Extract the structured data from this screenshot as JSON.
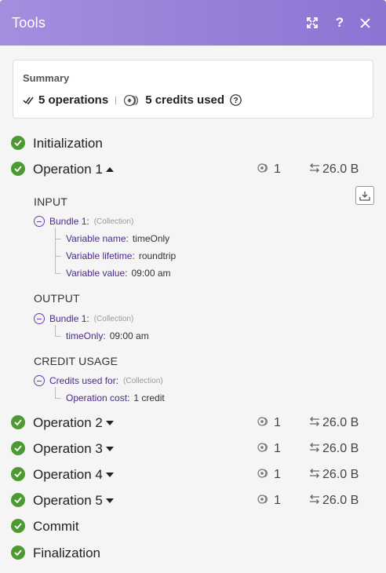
{
  "header": {
    "title": "Tools"
  },
  "summary": {
    "title": "Summary",
    "operations": "5 operations",
    "credits": "5 credits used"
  },
  "rows": {
    "initialization": "Initialization",
    "op1": {
      "label": "Operation 1",
      "count": "1",
      "size": "26.0 B"
    },
    "op2": {
      "label": "Operation 2",
      "count": "1",
      "size": "26.0 B"
    },
    "op3": {
      "label": "Operation 3",
      "count": "1",
      "size": "26.0 B"
    },
    "op4": {
      "label": "Operation 4",
      "count": "1",
      "size": "26.0 B"
    },
    "op5": {
      "label": "Operation 5",
      "count": "1",
      "size": "26.0 B"
    },
    "commit": "Commit",
    "finalization": "Finalization"
  },
  "details": {
    "input": {
      "heading": "INPUT",
      "bundle": "Bundle 1:",
      "type": "(Collection)",
      "items": [
        {
          "key": "Variable name:",
          "value": "timeOnly"
        },
        {
          "key": "Variable lifetime:",
          "value": "roundtrip"
        },
        {
          "key": "Variable value:",
          "value": "09:00 am"
        }
      ]
    },
    "output": {
      "heading": "OUTPUT",
      "bundle": "Bundle 1:",
      "type": "(Collection)",
      "items": [
        {
          "key": "timeOnly:",
          "value": "09:00 am"
        }
      ]
    },
    "credit_usage": {
      "heading": "CREDIT USAGE",
      "bundle": "Credits used for:",
      "type": "(Collection)",
      "items": [
        {
          "key": "Operation cost:",
          "value": "1 credit"
        }
      ]
    }
  },
  "colors": {
    "header_start": "#a58ddf",
    "header_end": "#8c74d3",
    "success": "#4e9a32",
    "key_text": "#4b2a8a"
  }
}
